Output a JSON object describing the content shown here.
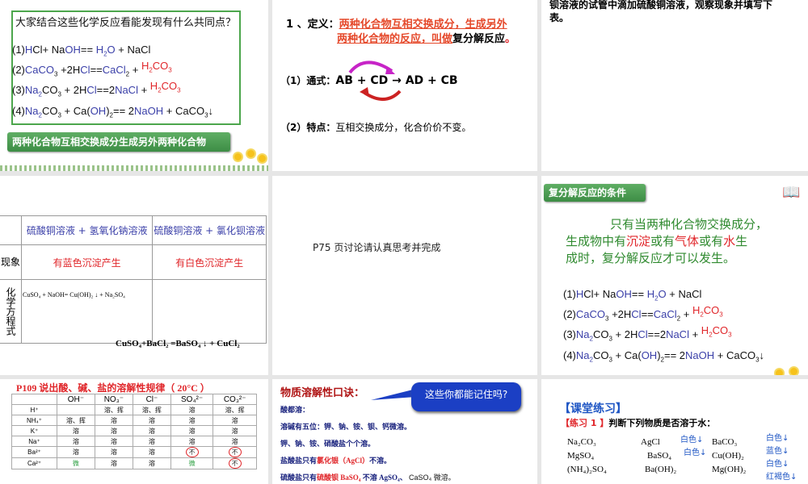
{
  "slide1": {
    "question": "大家结合这些化学反应看能发现有什么共同点？",
    "eq1": [
      "(1)",
      "H",
      "Cl+ Na",
      "OH",
      "== ",
      "H",
      "2",
      "O",
      " + NaCl"
    ],
    "eq2": [
      "(2)",
      "CaCO",
      "3",
      " +2H",
      "Cl",
      "==",
      "CaCl",
      "2",
      " + ",
      "H",
      "2",
      "CO",
      "3"
    ],
    "eq3": [
      "(3)",
      "Na",
      "2",
      "CO",
      "3",
      " + 2H",
      "Cl",
      "==2",
      "NaCl",
      " + ",
      "H",
      "2",
      "CO",
      "3"
    ],
    "eq4": [
      "(4)",
      "Na",
      "2",
      "CO",
      "3",
      " +  Ca(",
      "OH",
      ")",
      "2",
      "== 2",
      "NaOH",
      " + CaCO",
      "3",
      "↓"
    ],
    "banner": "两种化合物互相交换成分生成另外两种化合物"
  },
  "slide2": {
    "def_label": "1 、定义：",
    "def_red1": "两种化合物互相交换成分，生成另外",
    "def_red2": "两种化合物的反应，叫做",
    "def_black": "复分解反应",
    "def_dot": "。",
    "formula_label": "（1）通式：",
    "formula": "AB  +  CD → AD  + CB",
    "feature_label": "（2）特点：",
    "feature": "互相交换成分，化合价价不变。"
  },
  "slide3": {
    "text1": "钡溶液的试管中滴加硫酸铜溶液，观察现象并填写下",
    "text2": "表。"
  },
  "slide4": {
    "col1": "硫酸铜溶液 + 氢氧化钠溶液",
    "col2": "硫酸铜溶液 + 氯化钡溶液",
    "row1_label": "现象",
    "row1": [
      "有蓝色沉淀产生",
      "有白色沉淀产生"
    ],
    "row2_label": "化学方程式",
    "eq1": "CuSO₄ + NaOH= Cu(OH)₂ ↓ + Na₂SO₄",
    "eq2": "CuSO₄+BaCl₂ =BaSO₄ ↓ + CuCl₂"
  },
  "slide5": {
    "text": "P75 页讨论请认真思考并完成"
  },
  "slide6": {
    "banner": "复分解反应的条件",
    "p1": "只有当两种化合物交换成分，",
    "p2a": "生成物中有",
    "p2b": "沉淀",
    "p2c": "或有",
    "p2d": "气体",
    "p2e": "或有",
    "p2f": "水",
    "p2g": "生",
    "p3": "成时，复分解反应才可以发生。"
  },
  "slide7": {
    "title": "P109 说出酸、碱、盐的溶解性规律（ 20°C ）",
    "headers": [
      "",
      "OH⁻",
      "NO₃⁻",
      "Cl⁻",
      "SO₄²⁻",
      "CO₃²⁻"
    ],
    "rows": [
      [
        "H⁺",
        "",
        "溶、挥",
        "溶、挥",
        "溶",
        "溶、挥"
      ],
      [
        "NH₄⁺",
        "溶、挥",
        "溶",
        "溶",
        "溶",
        "溶"
      ],
      [
        "K⁺",
        "溶",
        "溶",
        "溶",
        "溶",
        "溶"
      ],
      [
        "Na⁺",
        "溶",
        "溶",
        "溶",
        "溶",
        "溶"
      ],
      [
        "Ba²⁺",
        "溶",
        "溶",
        "溶",
        "不",
        "不"
      ],
      [
        "Ca²⁺",
        "微",
        "溶",
        "溶",
        "微",
        "不"
      ]
    ]
  },
  "slide8": {
    "title": "物质溶解性口诀：",
    "bubble": "这些你都能记住吗?",
    "l1": "酸都溶：",
    "l2": "溶碱有五位：钾、钠、铵、钡、钙微溶。",
    "l3": "钾、钠、铵、硝酸盐个个溶。",
    "l4a": "盐酸盐只有",
    "l4b": "氯化银（AgCl）",
    "l4c": "不溶。",
    "l5a": "硫酸盐只有",
    "l5b": "硫酸钡 BaSO₄",
    "l5c": "不溶 AgSO₄、",
    "l5d": "CaSO₄ 微溶。"
  },
  "slide9": {
    "title": "【课堂练习】",
    "ex_label": "【练习 1 】",
    "ex_text": "判断下列物质是否溶于水：",
    "c1": [
      "Na₂CO₃",
      "MgSO₄",
      "(NH₄)₂SO₄"
    ],
    "c2": [
      "AgCl",
      "BaSO₄",
      "Ba(OH)₂"
    ],
    "c2n": [
      "白色↓",
      "白色↓"
    ],
    "c3": [
      "BaCO₃",
      "Cu(OH)₂",
      "Mg(OH)₂"
    ],
    "c3n": [
      "白色↓",
      "蓝色↓",
      "白色↓",
      "红褐色↓"
    ]
  }
}
